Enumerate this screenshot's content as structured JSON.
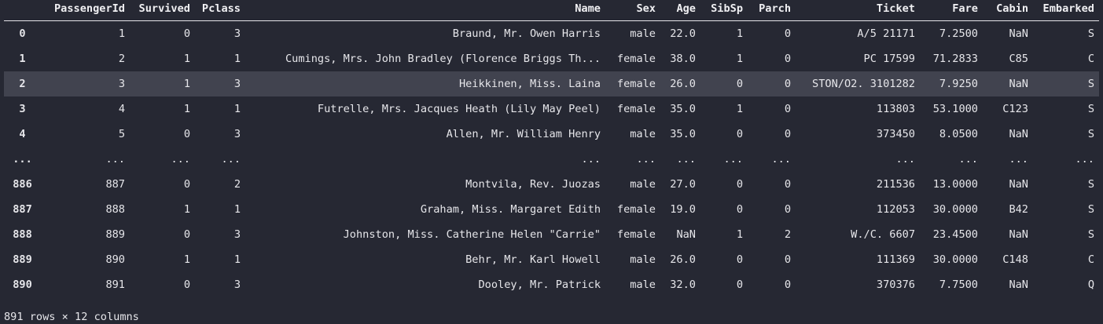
{
  "table": {
    "columns": [
      "",
      "PassengerId",
      "Survived",
      "Pclass",
      "Name",
      "Sex",
      "Age",
      "SibSp",
      "Parch",
      "Ticket",
      "Fare",
      "Cabin",
      "Embarked"
    ],
    "rows": [
      {
        "index": "0",
        "cells": [
          "1",
          "0",
          "3",
          "Braund, Mr. Owen Harris",
          "male",
          "22.0",
          "1",
          "0",
          "A/5 21171",
          "7.2500",
          "NaN",
          "S"
        ]
      },
      {
        "index": "1",
        "cells": [
          "2",
          "1",
          "1",
          "Cumings, Mrs. John Bradley (Florence Briggs Th...",
          "female",
          "38.0",
          "1",
          "0",
          "PC 17599",
          "71.2833",
          "C85",
          "C"
        ]
      },
      {
        "index": "2",
        "cells": [
          "3",
          "1",
          "3",
          "Heikkinen, Miss. Laina",
          "female",
          "26.0",
          "0",
          "0",
          "STON/O2. 3101282",
          "7.9250",
          "NaN",
          "S"
        ]
      },
      {
        "index": "3",
        "cells": [
          "4",
          "1",
          "1",
          "Futrelle, Mrs. Jacques Heath (Lily May Peel)",
          "female",
          "35.0",
          "1",
          "0",
          "113803",
          "53.1000",
          "C123",
          "S"
        ]
      },
      {
        "index": "4",
        "cells": [
          "5",
          "0",
          "3",
          "Allen, Mr. William Henry",
          "male",
          "35.0",
          "0",
          "0",
          "373450",
          "8.0500",
          "NaN",
          "S"
        ]
      },
      {
        "index": "...",
        "cells": [
          "...",
          "...",
          "...",
          "...",
          "...",
          "...",
          "...",
          "...",
          "...",
          "...",
          "...",
          "..."
        ]
      },
      {
        "index": "886",
        "cells": [
          "887",
          "0",
          "2",
          "Montvila, Rev. Juozas",
          "male",
          "27.0",
          "0",
          "0",
          "211536",
          "13.0000",
          "NaN",
          "S"
        ]
      },
      {
        "index": "887",
        "cells": [
          "888",
          "1",
          "1",
          "Graham, Miss. Margaret Edith",
          "female",
          "19.0",
          "0",
          "0",
          "112053",
          "30.0000",
          "B42",
          "S"
        ]
      },
      {
        "index": "888",
        "cells": [
          "889",
          "0",
          "3",
          "Johnston, Miss. Catherine Helen \"Carrie\"",
          "female",
          "NaN",
          "1",
          "2",
          "W./C. 6607",
          "23.4500",
          "NaN",
          "S"
        ]
      },
      {
        "index": "889",
        "cells": [
          "890",
          "1",
          "1",
          "Behr, Mr. Karl Howell",
          "male",
          "26.0",
          "0",
          "0",
          "111369",
          "30.0000",
          "C148",
          "C"
        ]
      },
      {
        "index": "890",
        "cells": [
          "891",
          "0",
          "3",
          "Dooley, Mr. Patrick",
          "male",
          "32.0",
          "0",
          "0",
          "370376",
          "7.7500",
          "NaN",
          "Q"
        ]
      }
    ],
    "hover_row_index": 2
  },
  "footer": {
    "shape_text": "891 rows × 12 columns"
  },
  "colors": {
    "background": "#262833",
    "hover_row": "#41434f",
    "text": "#e6e6ea"
  }
}
